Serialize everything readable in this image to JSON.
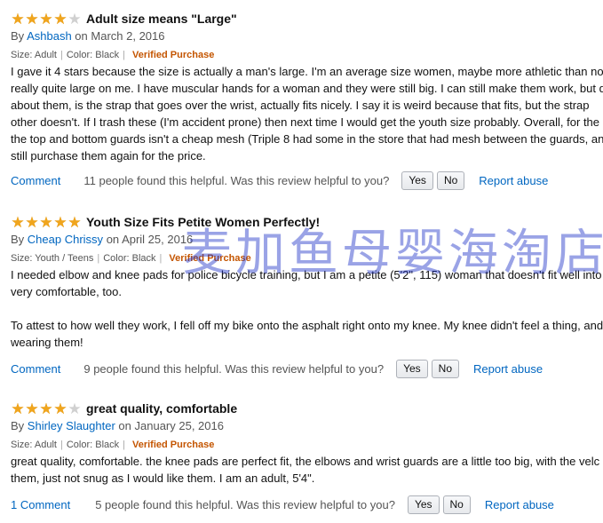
{
  "reviews": [
    {
      "rating": 4,
      "title": "Adult size means \"Large\"",
      "by_prefix": "By",
      "author": "Ashbash",
      "date_prefix": "on",
      "date": "March 2, 2016",
      "size": "Size: Adult",
      "color": "Color: Black",
      "verified": "Verified Purchase",
      "body": [
        "I gave it 4 stars because the size is actually a man's large. I'm an average size women, maybe more athletic than no",
        "really quite large on me. I have muscular hands for a woman and they were still big. I can still make them work, but d",
        "about them, is the strap that goes over the wrist, actually fits nicely. I say it is weird because that fits, but the strap",
        "other doesn't. If I trash these (I'm accident prone) then next time I would get the youth size probably. Overall, for the",
        "the top and bottom guards isn't a cheap mesh (Triple 8 had some in the store that had mesh between the guards, an",
        "still purchase them again for the price."
      ],
      "comment": "Comment",
      "helpful": "11 people found this helpful. Was this review helpful to you?",
      "yes": "Yes",
      "no": "No",
      "report": "Report abuse"
    },
    {
      "rating": 5,
      "title": "Youth Size Fits Petite Women Perfectly!",
      "by_prefix": "By",
      "author": "Cheap Chrissy",
      "date_prefix": "on",
      "date": "April 25, 2016",
      "size": "Size: Youth / Teens",
      "color": "Color: Black",
      "verified": "Verified Purchase",
      "body": [
        "I needed elbow and knee pads for police bicycle training, but I am a petite (5'2\", 115) woman that doesn't fit well into",
        "very comfortable, too.",
        "",
        "To attest to how well they work, I fell off my bike onto the asphalt right onto my knee. My knee didn't feel a thing, and",
        "wearing them!"
      ],
      "comment": "Comment",
      "helpful": "9 people found this helpful. Was this review helpful to you?",
      "yes": "Yes",
      "no": "No",
      "report": "Report abuse"
    },
    {
      "rating": 4,
      "title": "great quality, comfortable",
      "by_prefix": "By",
      "author": "Shirley Slaughter",
      "date_prefix": "on",
      "date": "January 25, 2016",
      "size": "Size: Adult",
      "color": "Color: Black",
      "verified": "Verified Purchase",
      "body": [
        "great quality, comfortable. the knee pads are perfect fit, the elbows and wrist guards are a little too big, with the velc",
        "them, just not snug as I would like them. I am an adult, 5'4\"."
      ],
      "comment": "1 Comment",
      "helpful": "5 people found this helpful. Was this review helpful to you?",
      "yes": "Yes",
      "no": "No",
      "report": "Report abuse"
    }
  ],
  "watermark": "麦加鱼母婴海淘店",
  "colors": {
    "star": "#f0a51d",
    "link": "#0066c0",
    "verified": "#c45500",
    "watermark": "#1e32c8"
  }
}
